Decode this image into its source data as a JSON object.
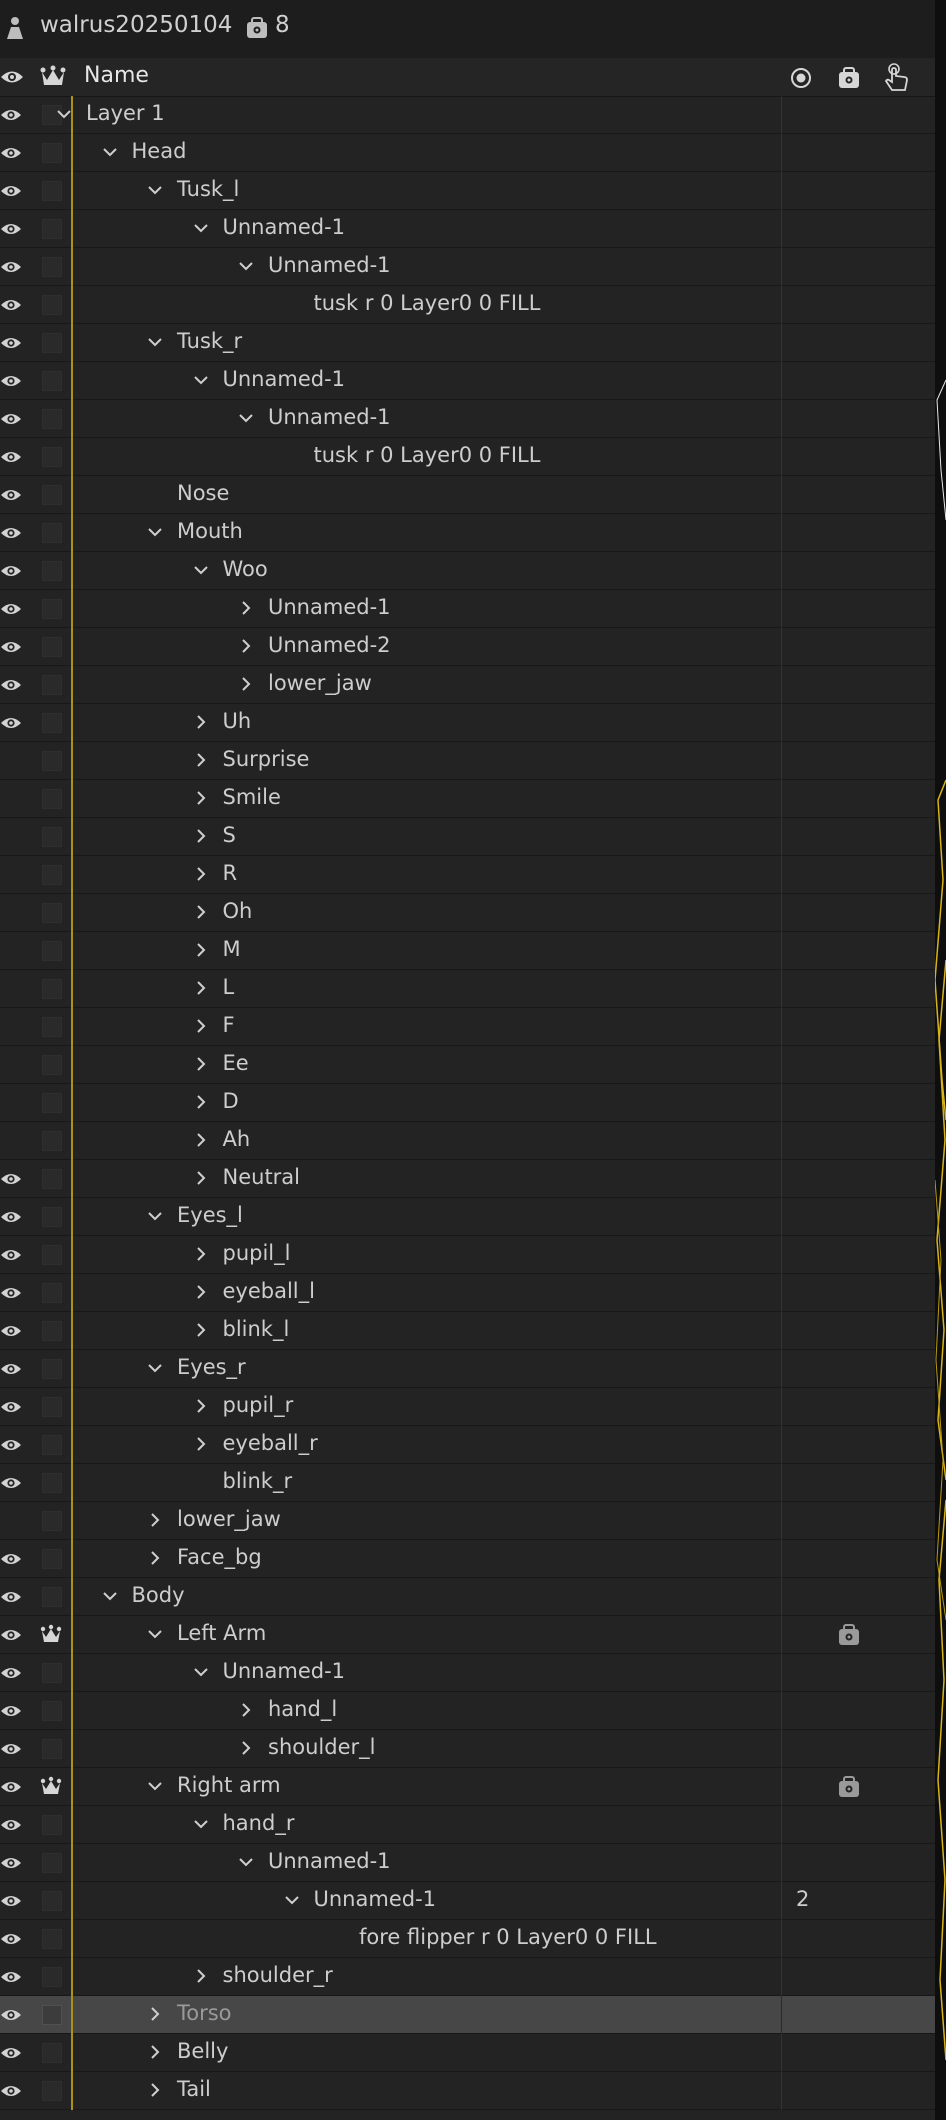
{
  "header": {
    "document_name": "walrus20250104",
    "rig_count": "8"
  },
  "columns": {
    "name": "Name"
  },
  "icons": {
    "eye": "eye-icon",
    "crown": "crown-handle-icon",
    "dot": "record-dot-icon",
    "rig": "behavior-icon",
    "hand": "touch-hand-icon",
    "puppet": "puppet-icon"
  },
  "colors": {
    "panel_bg": "#232323",
    "selected_row": "#474747",
    "guide_line": "#a99316",
    "artboard_line": "#d8b418"
  },
  "rows": [
    {
      "label": "Layer 1",
      "level": 0,
      "expander": "open",
      "eye": true
    },
    {
      "label": "Head",
      "level": 1,
      "expander": "open",
      "eye": true
    },
    {
      "label": "Tusk_l",
      "level": 2,
      "expander": "open",
      "eye": true
    },
    {
      "label": "Unnamed-1",
      "level": 3,
      "expander": "open",
      "eye": true
    },
    {
      "label": "Unnamed-1",
      "level": 4,
      "expander": "open",
      "eye": true
    },
    {
      "label": "tusk r 0 Layer0 0 FILL",
      "level": 5,
      "expander": "none",
      "eye": true
    },
    {
      "label": "Tusk_r",
      "level": 2,
      "expander": "open",
      "eye": true
    },
    {
      "label": "Unnamed-1",
      "level": 3,
      "expander": "open",
      "eye": true
    },
    {
      "label": "Unnamed-1",
      "level": 4,
      "expander": "open",
      "eye": true
    },
    {
      "label": "tusk r 0 Layer0 0 FILL",
      "level": 5,
      "expander": "none",
      "eye": true
    },
    {
      "label": "Nose",
      "level": 2,
      "expander": "none",
      "eye": true
    },
    {
      "label": "Mouth",
      "level": 2,
      "expander": "open",
      "eye": true
    },
    {
      "label": "Woo",
      "level": 3,
      "expander": "open",
      "eye": true
    },
    {
      "label": "Unnamed-1",
      "level": 4,
      "expander": "closed",
      "eye": true
    },
    {
      "label": "Unnamed-2",
      "level": 4,
      "expander": "closed",
      "eye": true
    },
    {
      "label": "lower_jaw",
      "level": 4,
      "expander": "closed",
      "eye": true
    },
    {
      "label": "Uh",
      "level": 3,
      "expander": "closed",
      "eye": true
    },
    {
      "label": "Surprise",
      "level": 3,
      "expander": "closed",
      "eye": false
    },
    {
      "label": "Smile",
      "level": 3,
      "expander": "closed",
      "eye": false
    },
    {
      "label": "S",
      "level": 3,
      "expander": "closed",
      "eye": false
    },
    {
      "label": "R",
      "level": 3,
      "expander": "closed",
      "eye": false
    },
    {
      "label": "Oh",
      "level": 3,
      "expander": "closed",
      "eye": false
    },
    {
      "label": "M",
      "level": 3,
      "expander": "closed",
      "eye": false
    },
    {
      "label": "L",
      "level": 3,
      "expander": "closed",
      "eye": false
    },
    {
      "label": "F",
      "level": 3,
      "expander": "closed",
      "eye": false
    },
    {
      "label": "Ee",
      "level": 3,
      "expander": "closed",
      "eye": false
    },
    {
      "label": "D",
      "level": 3,
      "expander": "closed",
      "eye": false
    },
    {
      "label": "Ah",
      "level": 3,
      "expander": "closed",
      "eye": false
    },
    {
      "label": "Neutral",
      "level": 3,
      "expander": "closed",
      "eye": true
    },
    {
      "label": "Eyes_l",
      "level": 2,
      "expander": "open",
      "eye": true
    },
    {
      "label": "pupil_l",
      "level": 3,
      "expander": "closed",
      "eye": true
    },
    {
      "label": "eyeball_l",
      "level": 3,
      "expander": "closed",
      "eye": true
    },
    {
      "label": "blink_l",
      "level": 3,
      "expander": "closed",
      "eye": true
    },
    {
      "label": "Eyes_r",
      "level": 2,
      "expander": "open",
      "eye": true
    },
    {
      "label": "pupil_r",
      "level": 3,
      "expander": "closed",
      "eye": true
    },
    {
      "label": "eyeball_r",
      "level": 3,
      "expander": "closed",
      "eye": true
    },
    {
      "label": "blink_r",
      "level": 3,
      "expander": "none",
      "eye": true
    },
    {
      "label": "lower_jaw",
      "level": 2,
      "expander": "closed",
      "eye": false
    },
    {
      "label": "Face_bg",
      "level": 2,
      "expander": "closed",
      "eye": true
    },
    {
      "label": "Body",
      "level": 1,
      "expander": "open",
      "eye": true
    },
    {
      "label": "Left Arm",
      "level": 2,
      "expander": "open",
      "eye": true,
      "crown": true,
      "rig": true
    },
    {
      "label": "Unnamed-1",
      "level": 3,
      "expander": "open",
      "eye": true
    },
    {
      "label": "hand_l",
      "level": 4,
      "expander": "closed",
      "eye": true
    },
    {
      "label": "shoulder_l",
      "level": 4,
      "expander": "closed",
      "eye": true
    },
    {
      "label": "Right arm",
      "level": 2,
      "expander": "open",
      "eye": true,
      "crown": true,
      "rig": true
    },
    {
      "label": "hand_r",
      "level": 3,
      "expander": "open",
      "eye": true
    },
    {
      "label": "Unnamed-1",
      "level": 4,
      "expander": "open",
      "eye": true
    },
    {
      "label": "Unnamed-1",
      "level": 5,
      "expander": "open",
      "eye": true,
      "count": "2"
    },
    {
      "label": "fore flipper r 0 Layer0 0 FILL",
      "level": 6,
      "expander": "none",
      "eye": true
    },
    {
      "label": "shoulder_r",
      "level": 3,
      "expander": "closed",
      "eye": true
    },
    {
      "label": "Torso",
      "level": 2,
      "expander": "closed",
      "eye": true,
      "selected": true
    },
    {
      "label": "Belly",
      "level": 2,
      "expander": "closed",
      "eye": true
    },
    {
      "label": "Tail",
      "level": 2,
      "expander": "closed",
      "eye": true
    }
  ]
}
